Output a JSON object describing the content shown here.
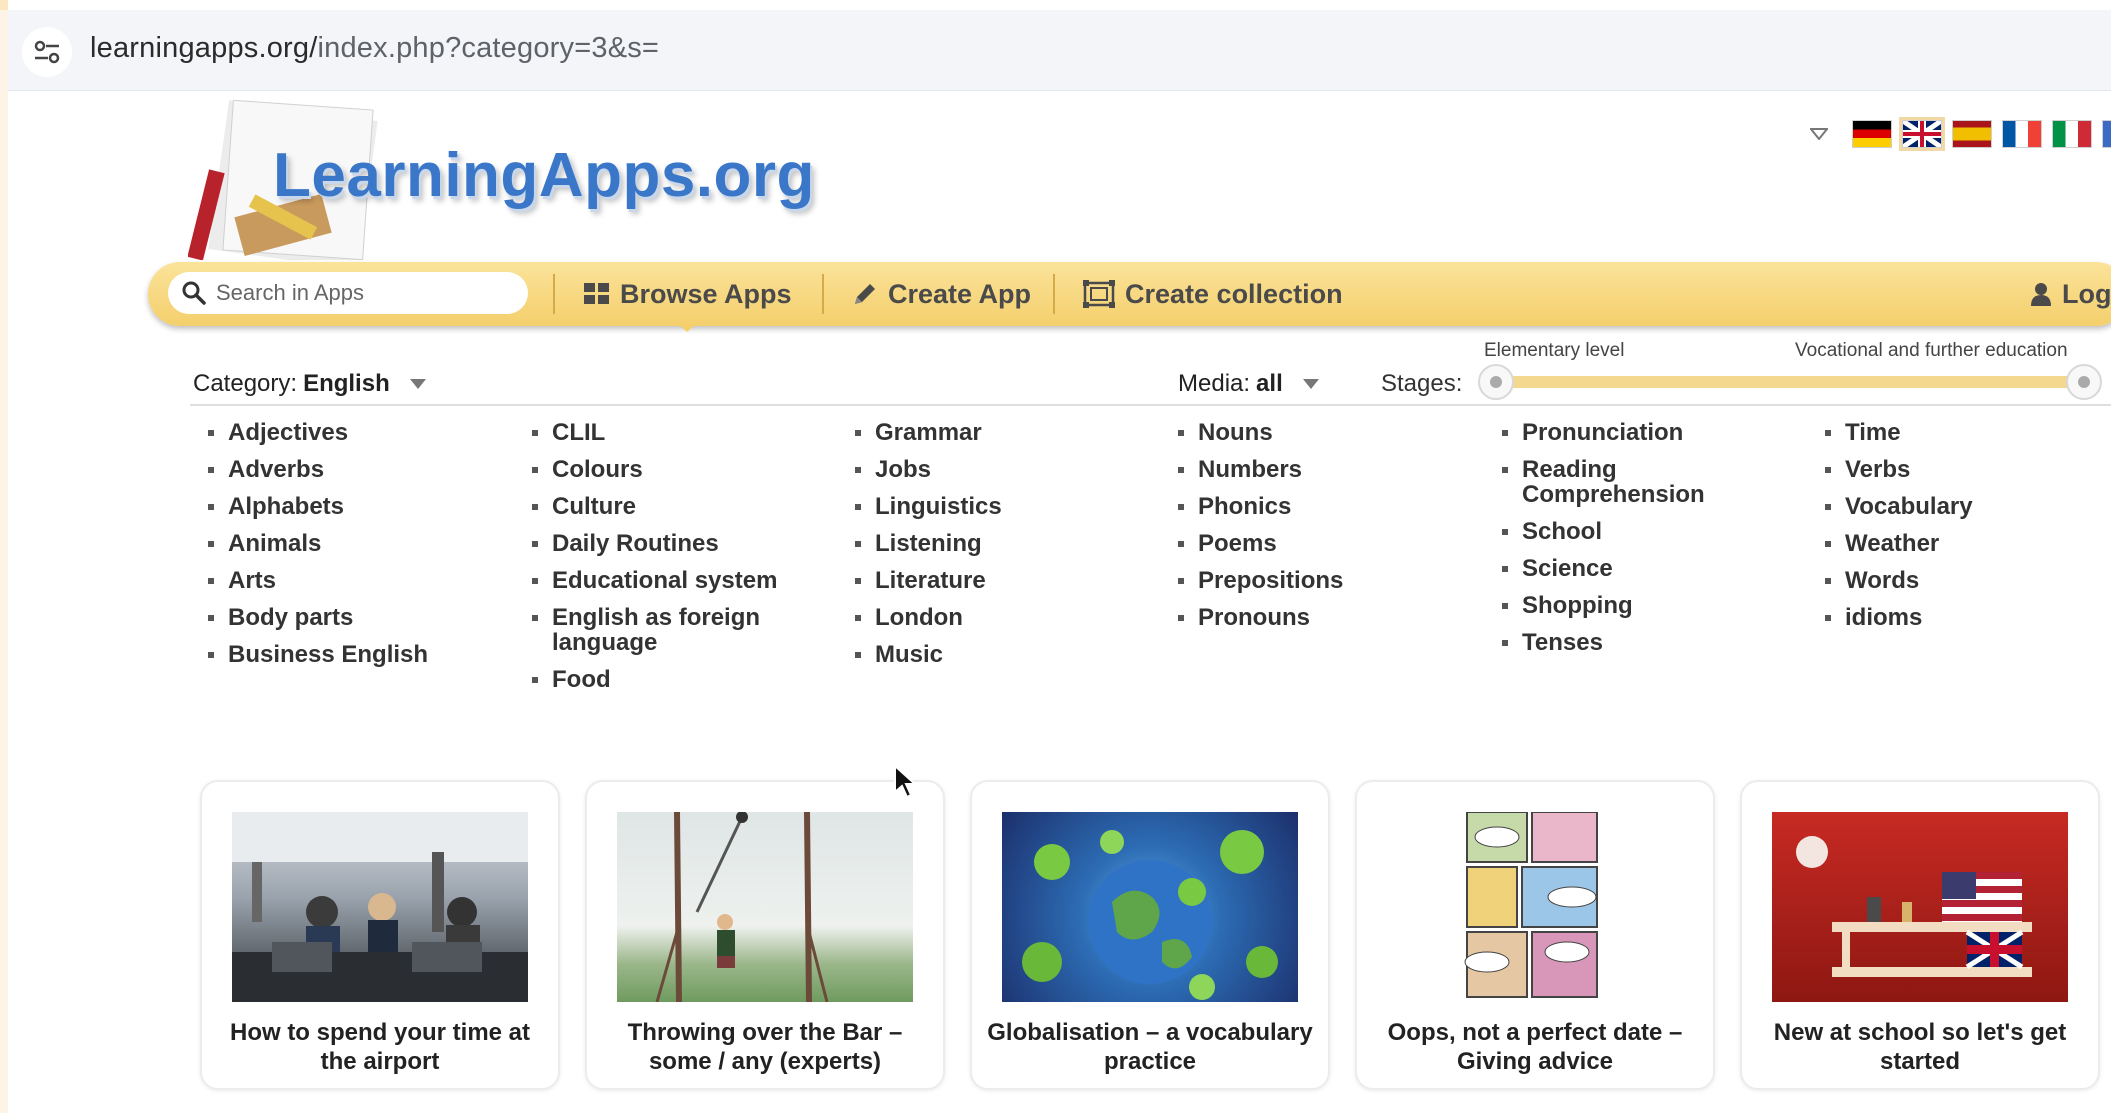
{
  "browser": {
    "url_domain": "learningapps.org/",
    "url_rest": "index.php?category=3&s="
  },
  "logo": {
    "text": "LearningApps.org"
  },
  "languages": [
    {
      "code": "de",
      "colors": [
        "#000000",
        "#dd0000",
        "#ffce00"
      ]
    },
    {
      "code": "en",
      "colors": [
        "#012169",
        "#ffffff",
        "#c8102e"
      ],
      "selected": true
    },
    {
      "code": "es",
      "colors": [
        "#aa151b",
        "#f1bf00",
        "#aa151b"
      ]
    },
    {
      "code": "fr",
      "colors": [
        "#0055a4",
        "#ffffff",
        "#ef4135"
      ]
    },
    {
      "code": "it",
      "colors": [
        "#009246",
        "#ffffff",
        "#ce2b37"
      ]
    }
  ],
  "toolbar": {
    "search_placeholder": "Search in Apps",
    "browse_label": "Browse Apps",
    "create_app_label": "Create App",
    "create_collection_label": "Create collection",
    "login_label": "Logi"
  },
  "filters": {
    "category_label": "Category:",
    "category_value": "English",
    "media_label": "Media:",
    "media_value": "all",
    "stages_label": "Stages:",
    "stage_min_label": "Elementary level",
    "stage_max_label": "Vocational and further education"
  },
  "topics": [
    [
      "Adjectives",
      "Adverbs",
      "Alphabets",
      "Animals",
      "Arts",
      "Body parts",
      "Business English"
    ],
    [
      "CLIL",
      "Colours",
      "Culture",
      "Daily Routines",
      "Educational system",
      "English as foreign language",
      "Food"
    ],
    [
      "Grammar",
      "Jobs",
      "Linguistics",
      "Listening",
      "Literature",
      "London",
      "Music"
    ],
    [
      "Nouns",
      "Numbers",
      "Phonics",
      "Poems",
      "Prepositions",
      "Pronouns"
    ],
    [
      "Pronunciation",
      "Reading Comprehension",
      "School",
      "Science",
      "Shopping",
      "Tenses"
    ],
    [
      "Time",
      "Verbs",
      "Vocabulary",
      "Weather",
      "Words",
      "idioms"
    ]
  ],
  "cards": [
    {
      "title": "How to spend your time at the airport"
    },
    {
      "title": "Throwing over the Bar – some / any (experts)"
    },
    {
      "title": "Globalisation – a vocabulary practice"
    },
    {
      "title": "Oops, not a perfect date – Giving advice"
    },
    {
      "title": "New at school so let's get started"
    }
  ],
  "colors": {
    "accent": "#f4cf6c",
    "logo_blue": "#3a77c8"
  }
}
